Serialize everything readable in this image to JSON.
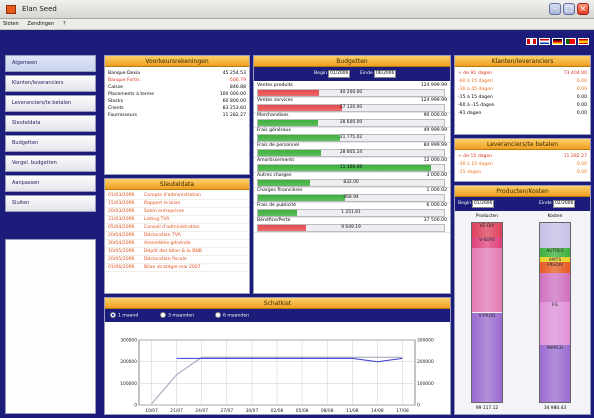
{
  "window": {
    "title": "Elan Seed"
  },
  "menu": [
    "Sloten",
    "Zendingen",
    "?"
  ],
  "sidebar": {
    "items": [
      "Algemeen",
      "Klanten/leveranciers",
      "Leveranciers/te betalen",
      "Sleuteldata",
      "Budgetten",
      "Vergel. budgetten",
      "Aanpassen",
      "Sluiten"
    ]
  },
  "voorkoers": {
    "title": "Voorkeursrekeningen",
    "rows": [
      {
        "label": "Banque Dexia",
        "value": "45 254.53",
        "red": false
      },
      {
        "label": "Banque Fortis",
        "value": "-506.79",
        "red": true
      },
      {
        "label": "Caisse",
        "value": "846.88",
        "red": false
      },
      {
        "label": "Placements à terme",
        "value": "100 000.00",
        "red": false
      },
      {
        "label": "Stocks",
        "value": "60 800.00",
        "red": false
      },
      {
        "label": "Clients",
        "value": "83 253.60",
        "red": false
      },
      {
        "label": "Fournisseurs",
        "value": "11 282.27",
        "red": false
      }
    ]
  },
  "sleuteldata": {
    "title": "Sleuteldata",
    "items": [
      {
        "date": "01/03/2006",
        "text": "Compte d'administration"
      },
      {
        "date": "15/03/2006",
        "text": "Rapport le bilan"
      },
      {
        "date": "20/03/2006",
        "text": "Salon entreprises"
      },
      {
        "date": "31/03/2006",
        "text": "Listing TVA"
      },
      {
        "date": "05/04/2006",
        "text": "Conseil d'administration"
      },
      {
        "date": "20/04/2006",
        "text": "Déclaration TVA"
      },
      {
        "date": "30/04/2006",
        "text": "Assemblée générale"
      },
      {
        "date": "10/05/2006",
        "text": "Dépôt des bilan & la BNB"
      },
      {
        "date": "20/05/2006",
        "text": "Déclaration fiscale"
      },
      {
        "date": "01/06/2006",
        "text": "Bilan stratégie mai 2007"
      }
    ]
  },
  "budgetten": {
    "title": "Budgetten",
    "begin_label": "Begin",
    "begin": "01/2006",
    "einde_label": "Einde",
    "einde": "06/2006",
    "rows": [
      {
        "label": "Ventes produits",
        "budget": "124 999.99",
        "actual": "40 200.00",
        "pct": 0.33,
        "color": "#e84a4a"
      },
      {
        "label": "Ventes services",
        "budget": "124 999.99",
        "actual": "57 120.00",
        "pct": 0.45,
        "color": "#e84a4a"
      },
      {
        "label": "Marchandises",
        "budget": "90 000.00",
        "actual": "28 600.00",
        "pct": 0.32,
        "color": "#3cb03c"
      },
      {
        "label": "Frais généraux",
        "budget": "49 999.99",
        "actual": "21 775.02",
        "pct": 0.44,
        "color": "#3cb03c"
      },
      {
        "label": "Frais de personnel",
        "budget": "84 999.99",
        "actual": "28 805.24",
        "pct": 0.34,
        "color": "#3cb03c"
      },
      {
        "label": "Amortissements",
        "budget": "12 000.00",
        "actual": "11 166.66",
        "pct": 0.93,
        "color": "#3cb03c"
      },
      {
        "label": "Autres charges",
        "budget": "3 000.00",
        "actual": "832.00",
        "pct": 0.28,
        "color": "#3cb03c"
      },
      {
        "label": "Charges financières",
        "budget": "1 000.02",
        "actual": "468.94",
        "pct": 0.47,
        "color": "#3cb03c"
      },
      {
        "label": "Frais de publicité",
        "budget": "6 000.00",
        "actual": "1 251.81",
        "pct": 0.21,
        "color": "#3cb03c"
      },
      {
        "label": "Bénéfice/Perte",
        "budget": "37 500.00",
        "actual": "9 649.19",
        "pct": 0.26,
        "color": "#e84a4a"
      }
    ]
  },
  "klanten": {
    "title": "Klanten/leveranciers",
    "rows": [
      {
        "label": "+ de 91 dagen",
        "value": "73 404.00",
        "cls": "red"
      },
      {
        "label": "-60 à 15 dagen",
        "value": "0.00",
        "cls": "orange"
      },
      {
        "label": "-30 à 45 dagen",
        "value": "0.00",
        "cls": "orange"
      },
      {
        "label": "-15 à 15 dagen",
        "value": "0.00",
        "cls": ""
      },
      {
        "label": "-60 à -15 dagen",
        "value": "0.00",
        "cls": ""
      },
      {
        "label": "-91 dagen",
        "value": "0.00",
        "cls": ""
      }
    ]
  },
  "leveranciers": {
    "title": "Leveranciers/te betalen",
    "rows": [
      {
        "label": "+ de 15 dagen",
        "value": "11 282.27",
        "cls": "red"
      },
      {
        "label": "-30 à 15 dagen",
        "value": "0.00",
        "cls": "orange"
      },
      {
        "label": "-15 dagen",
        "value": "0.00",
        "cls": "orange"
      }
    ]
  },
  "producten": {
    "title": "Producten/Kosten",
    "begin_label": "Begin",
    "begin": "01/2006",
    "einde_label": "Einde",
    "einde": "02/2006",
    "col1_title": "Producten",
    "col2_title": "Kosten",
    "col1_total": "99 117.12",
    "col2_total": "34 980.43",
    "col1_segments": [
      {
        "label": "VE-DIV",
        "frac": 0.08,
        "color": "#e0405a"
      },
      {
        "label": "V-SERV",
        "frac": 0.06,
        "color": "#e0407a"
      },
      {
        "label": "",
        "frac": 0.36,
        "color": "#e47ab4"
      },
      {
        "label": "V-PROD",
        "frac": 0.5,
        "color": "#9a6ad0"
      }
    ],
    "col2_segments": [
      {
        "label": "",
        "frac": 0.14,
        "color": "#c8c0e8"
      },
      {
        "label": "AUTRES",
        "frac": 0.05,
        "color": "#3cb03c"
      },
      {
        "label": "AMTS",
        "frac": 0.03,
        "color": "#e8d020"
      },
      {
        "label": "FRSDIV",
        "frac": 0.06,
        "color": "#e85a20"
      },
      {
        "label": "",
        "frac": 0.16,
        "color": "#d070c0"
      },
      {
        "label": "FG",
        "frac": 0.24,
        "color": "#e090d8"
      },
      {
        "label": "MARCH",
        "frac": 0.32,
        "color": "#9a6ad0"
      }
    ]
  },
  "schatkist": {
    "title": "Schatkist",
    "options": [
      "1 maand",
      "3 maanden",
      "6 maanden"
    ],
    "selected": 0
  },
  "chart_data": {
    "type": "line",
    "title": "",
    "categories": [
      "10/07",
      "21/07",
      "24/07",
      "27/07",
      "30/07",
      "02/08",
      "05/08",
      "08/08",
      "11/08",
      "14/08",
      "17/08"
    ],
    "series": [
      {
        "values": [
          5000,
          140000,
          220000,
          220000,
          220000,
          220000,
          220000,
          220000,
          220000,
          220000,
          220000
        ],
        "color": "#9aa0b8"
      },
      {
        "values": [
          null,
          215000,
          215000,
          215000,
          215000,
          215000,
          215000,
          215000,
          215000,
          200000,
          215000
        ],
        "color": "#3a3ad0"
      }
    ],
    "ylim": [
      0,
      300000
    ],
    "yticks": [
      "300000",
      "200000",
      "100000",
      "0"
    ],
    "grid": true
  }
}
